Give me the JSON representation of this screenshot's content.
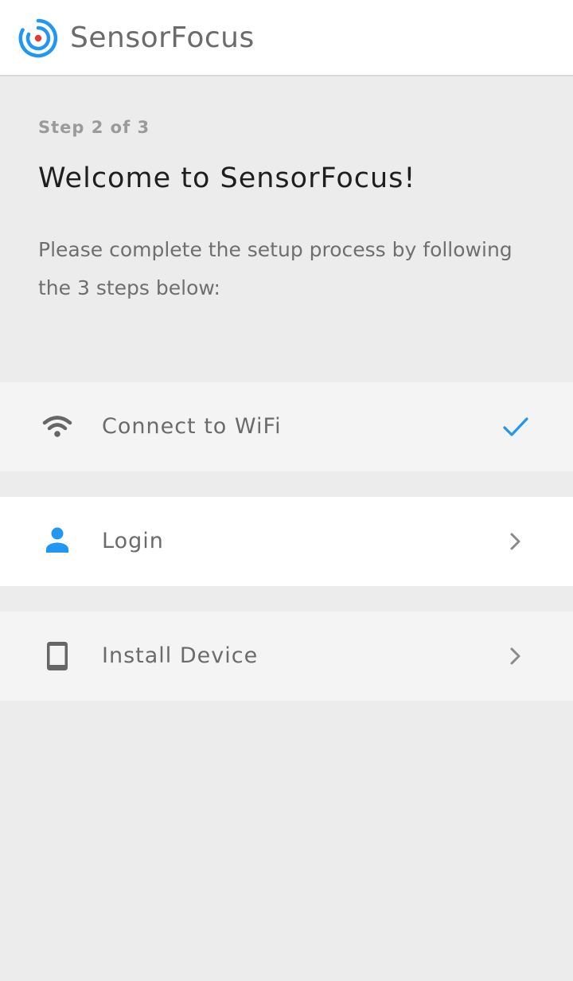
{
  "app": {
    "title": "SensorFocus"
  },
  "setup": {
    "step_indicator": "Step 2 of 3",
    "title": "Welcome to SensorFocus!",
    "description": "Please complete the setup process by following the 3 steps below:"
  },
  "steps": [
    {
      "label": "Connect to WiFi",
      "icon": "wifi-icon",
      "status": "completed",
      "status_icon": "check-icon"
    },
    {
      "label": "Login",
      "icon": "person-icon",
      "status": "pending",
      "status_icon": "chevron-right-icon"
    },
    {
      "label": "Install Device",
      "icon": "phone-icon",
      "status": "pending",
      "status_icon": "chevron-right-icon"
    }
  ],
  "colors": {
    "accent": "#2196f3",
    "logo_dot": "#e53935",
    "background": "#ececec",
    "text_primary": "#1f1f1f",
    "text_secondary": "#6b6b6b"
  }
}
